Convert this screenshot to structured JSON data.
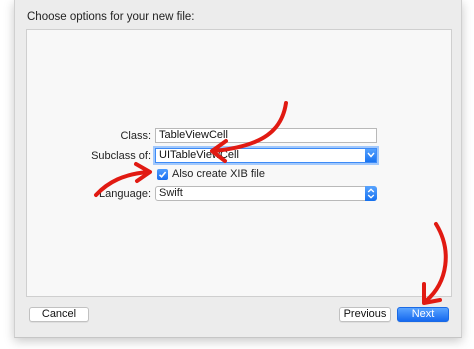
{
  "dialog": {
    "title": "Choose options for your new file:"
  },
  "form": {
    "class_label": "Class:",
    "class_value": "TableViewCell",
    "subclass_label": "Subclass of:",
    "subclass_value": "UITableViewCell",
    "xib_checkbox_label": "Also create XIB file",
    "xib_checked": true,
    "language_label": "Language:",
    "language_value": "Swift"
  },
  "buttons": {
    "cancel": "Cancel",
    "previous": "Previous",
    "next": "Next"
  },
  "colors": {
    "accent": "#1a6ff0",
    "annotation_arrows": "#e11a12"
  }
}
